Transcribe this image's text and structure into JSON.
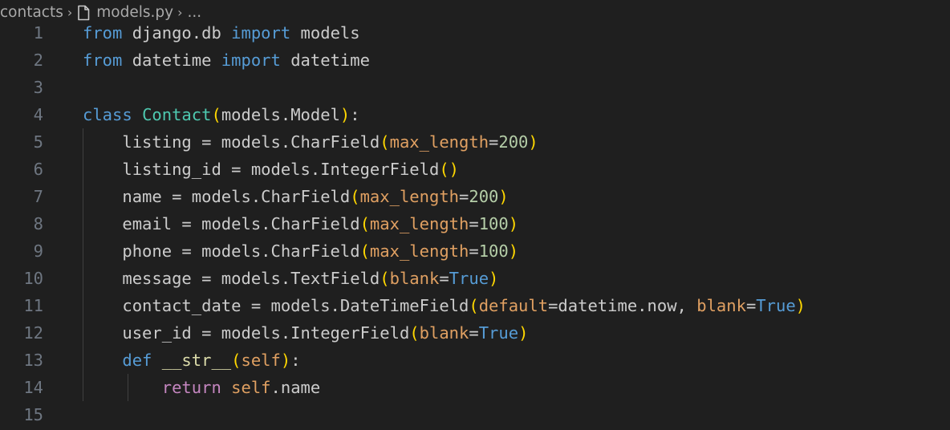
{
  "breadcrumb": {
    "folder": "contacts",
    "separator": "›",
    "file": "models.py",
    "tail": "..."
  },
  "icons": {
    "file": "file-icon",
    "chevron": "chevron-right-icon"
  },
  "code": {
    "lines": [
      {
        "n": "1",
        "text": "from django.db import models"
      },
      {
        "n": "2",
        "text": "from datetime import datetime"
      },
      {
        "n": "3",
        "text": ""
      },
      {
        "n": "4",
        "text": "class Contact(models.Model):"
      },
      {
        "n": "5",
        "text": "    listing = models.CharField(max_length=200)"
      },
      {
        "n": "6",
        "text": "    listing_id = models.IntegerField()"
      },
      {
        "n": "7",
        "text": "    name = models.CharField(max_length=200)"
      },
      {
        "n": "8",
        "text": "    email = models.CharField(max_length=100)"
      },
      {
        "n": "9",
        "text": "    phone = models.CharField(max_length=100)"
      },
      {
        "n": "10",
        "text": "    message = models.TextField(blank=True)"
      },
      {
        "n": "11",
        "text": "    contact_date = models.DateTimeField(default=datetime.now, blank=True)"
      },
      {
        "n": "12",
        "text": "    user_id = models.IntegerField(blank=True)"
      },
      {
        "n": "13",
        "text": "    def __str__(self):"
      },
      {
        "n": "14",
        "text": "        return self.name"
      },
      {
        "n": "15",
        "text": ""
      }
    ]
  },
  "colors": {
    "background": "#1f1f1f",
    "keyword": "#569cd6",
    "control_keyword": "#c586c0",
    "class_name": "#4ec9b0",
    "function": "#dcdcaa",
    "parameter": "#e0a062",
    "number": "#b5cea8",
    "bracket": "#ffd700",
    "line_number": "#6e7681"
  }
}
